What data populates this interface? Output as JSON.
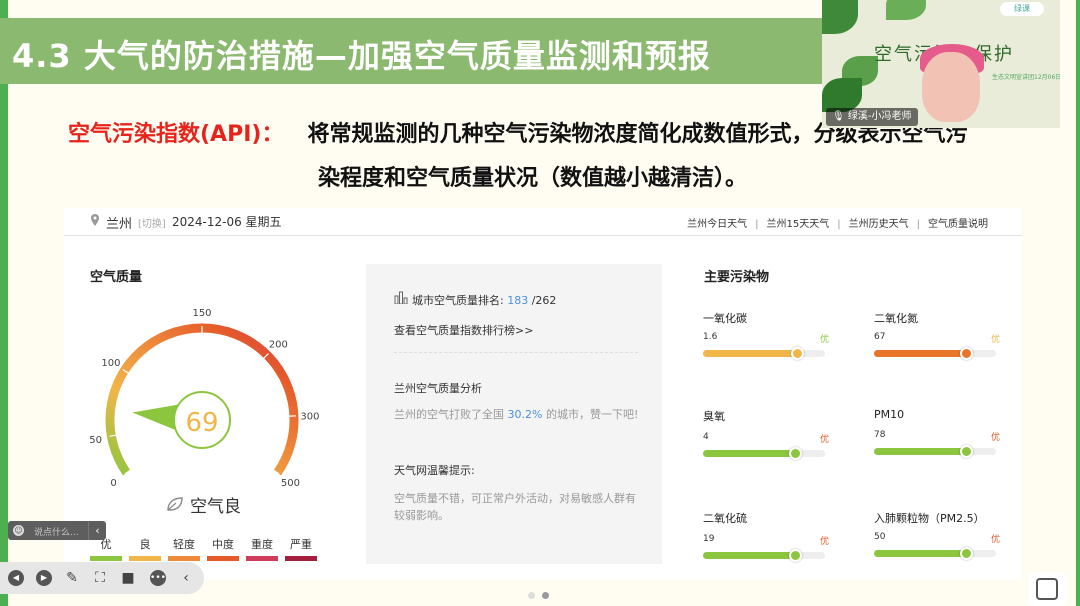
{
  "slide": {
    "title": "4.3  大气的防治措施—加强空气质量监测和预报",
    "term": "空气污染指数(API)：",
    "definition_line1": "将常规监测的几种空气污染物浓度简化成数值形式，分级表示空气污",
    "definition_line2": "染程度和空气质量状况（数值越小越清洁）。"
  },
  "webcam": {
    "banner_text": "空气污染与保护",
    "banner_subtext": "生态文明宣讲团12月06日",
    "logo_text": "绿课",
    "presenter_label": "绿溪-小冯老师"
  },
  "weather": {
    "city": "兰州",
    "switch_label": "[切换]",
    "date": "2024-12-06 星期五",
    "nav": [
      "兰州今日天气",
      "兰州15天天气",
      "兰州历史天气",
      "空气质量说明"
    ]
  },
  "gauge": {
    "section_title": "空气质量",
    "aqi_value": "69",
    "aqi_level": "空气良",
    "ticks": [
      {
        "label": "0",
        "value": 0
      },
      {
        "label": "50",
        "value": 50
      },
      {
        "label": "100",
        "value": 100
      },
      {
        "label": "150",
        "value": 150
      },
      {
        "label": "200",
        "value": 200
      },
      {
        "label": "300",
        "value": 300
      },
      {
        "label": "500",
        "value": 500
      }
    ],
    "value": 69,
    "pointer_color": "#8cc63f"
  },
  "legend": [
    {
      "label": "优",
      "color": "#8cc63f"
    },
    {
      "label": "良",
      "color": "#f0b64a"
    },
    {
      "label": "轻度",
      "color": "#ee8a3a"
    },
    {
      "label": "中度",
      "color": "#e55a2a"
    },
    {
      "label": "重度",
      "color": "#cf3b5c"
    },
    {
      "label": "严重",
      "color": "#a31f3e"
    }
  ],
  "ranking": {
    "prefix": "城市空气质量排名:",
    "rank": "183",
    "total": "/262",
    "link": "查看空气质量指数排行榜>>",
    "analysis_title": "兰州空气质量分析",
    "analysis_pre": "兰州的空气打败了全国",
    "analysis_pct": "30.2%",
    "analysis_post": "的城市，赞一下吧!",
    "tip_title": "天气网温馨提示:",
    "tip_text": "空气质量不错，可正常户外活动，对易敏感人群有较弱影响。"
  },
  "pollutants": {
    "title": "主要污染物",
    "items": [
      {
        "name": "一氧化碳",
        "value": "1.6",
        "level": "优",
        "fraction": 0.78,
        "color": "#f0b64a",
        "level_color": "#8cc63f"
      },
      {
        "name": "二氧化氮",
        "value": "67",
        "level": "优",
        "fraction": 0.76,
        "color": "#e8752a",
        "level_color": "#f0b64a"
      },
      {
        "name": "臭氧",
        "value": "4",
        "level": "优",
        "fraction": 0.76,
        "color": "#8cc63f",
        "level_color": "#e55a2a"
      },
      {
        "name": "PM10",
        "value": "78",
        "level": "优",
        "fraction": 0.76,
        "color": "#8cc63f",
        "level_color": "#e55a2a"
      },
      {
        "name": "二氧化硫",
        "value": "19",
        "level": "优",
        "fraction": 0.76,
        "color": "#8cc63f",
        "level_color": "#e55a2a"
      },
      {
        "name": "入肺颗粒物（PM2.5）",
        "value": "50",
        "level": "优",
        "fraction": 0.76,
        "color": "#8cc63f",
        "level_color": "#e55a2a"
      }
    ]
  },
  "comment": {
    "placeholder": "说点什么...",
    "collapse": "‹"
  },
  "toolbar": {
    "icons": [
      "prev-icon",
      "next-icon",
      "pen-icon",
      "screenshot-icon",
      "camera-icon",
      "more-icon",
      "collapse-icon"
    ]
  },
  "pager": {
    "pages": 2,
    "current": 2
  }
}
